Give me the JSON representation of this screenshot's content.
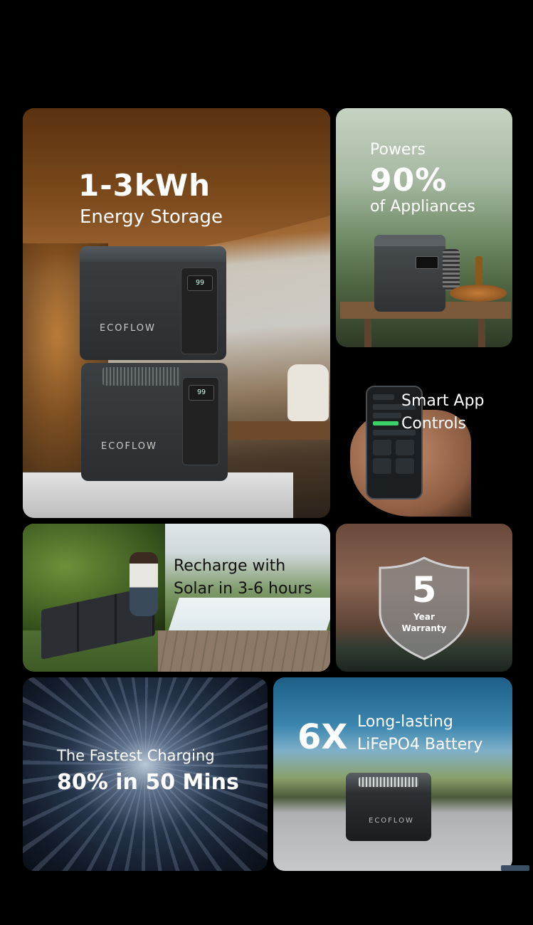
{
  "tiles": {
    "energy_storage": {
      "headline": "1-3kWh",
      "subhead": "Energy Storage",
      "brand_top": "ECOFLOW",
      "brand_bottom": "ECOFLOW",
      "screen_top": "99",
      "screen_bottom": "99"
    },
    "appliances": {
      "line1": "Powers",
      "line2": "90%",
      "line3": "of Appliances"
    },
    "app": {
      "line1": "Smart App",
      "line2": "Controls"
    },
    "solar": {
      "line1": "Recharge with",
      "line2": "Solar in 3-6 hours"
    },
    "warranty": {
      "number": "5",
      "line1": "Year",
      "line2": "Warranty"
    },
    "fast_charging": {
      "line1": "The Fastest Charging",
      "line2": "80% in 50 Mins"
    },
    "battery": {
      "multiplier": "6X",
      "line1": "Long-lasting",
      "line2": "LiFePO4 Battery",
      "brand": "ECOFLOW"
    }
  },
  "colors": {
    "background": "#000000",
    "text": "#ffffff",
    "solar_text": "#111111"
  }
}
